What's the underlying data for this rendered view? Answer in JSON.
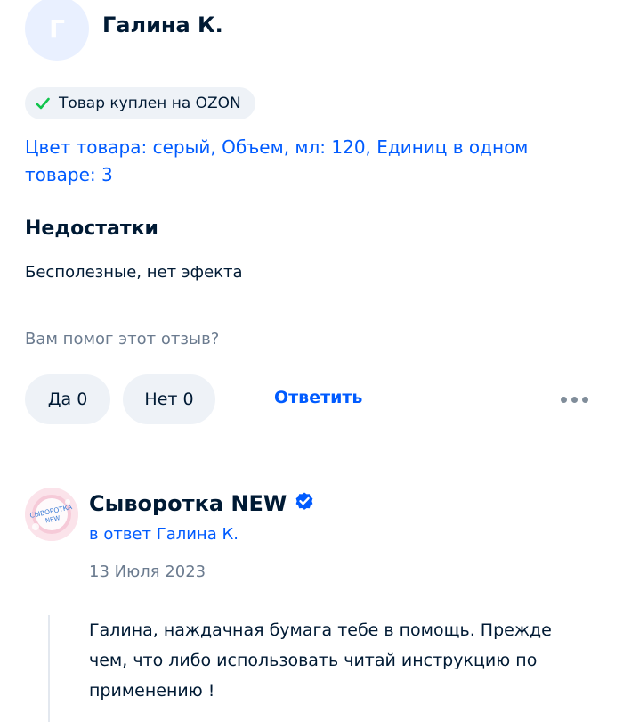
{
  "review": {
    "author": {
      "initial": "Г",
      "name": "Галина К."
    },
    "purchase_badge": {
      "label": "Товар куплен на OZON",
      "icon": "check-icon"
    },
    "product_variant": "Цвет товара: серый, Объем, мл: 120, Единиц в одном товаре: 3",
    "cons": {
      "title": "Недостатки",
      "text": "Бесполезные, нет эфекта"
    },
    "helpful": {
      "question": "Вам помог этот отзыв?",
      "yes_label": "Да 0",
      "no_label": "Нет 0"
    },
    "reply_label": "Ответить",
    "more_icon": "more-dots-icon"
  },
  "seller_reply": {
    "avatar_text_line1": "СЫВОРОТКА",
    "avatar_text_line2": "NEW",
    "seller_name": "Сыворотка NEW",
    "verified_icon": "verified-check-icon",
    "reply_to": "в ответ Галина К.",
    "date": "13 Июля 2023",
    "text": "Галина, наждачная бумага тебе в помощь. Прежде чем, что либо использовать читай инструкцию по применению !"
  },
  "colors": {
    "accent_blue": "#005bff",
    "text_primary": "#001a34",
    "text_secondary": "#6b7b8f",
    "pill_background": "#eef2f7",
    "check_green": "#10c44c",
    "avatar_background": "#e9f0ff"
  }
}
